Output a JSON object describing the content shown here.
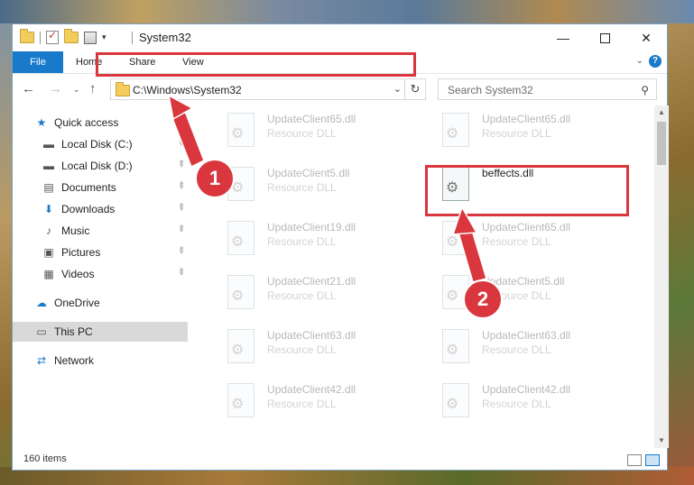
{
  "window": {
    "title": "System32",
    "minimize": "—",
    "close": "✕"
  },
  "ribbon": {
    "tabs": [
      "File",
      "Home",
      "Share",
      "View"
    ],
    "help": "?",
    "chevron": "⌄"
  },
  "nav": {
    "back": "←",
    "forward": "→",
    "recent": "⌄",
    "up": "↑",
    "address": "C:\\Windows\\System32",
    "address_dropdown": "⌄",
    "refresh": "↻",
    "search_placeholder": "Search System32",
    "search_icon": "⚲"
  },
  "sidebar": {
    "items": [
      {
        "label": "Quick access",
        "icon": "star-icon",
        "glyph": "★",
        "pinned": false,
        "selected": false,
        "indent": false
      },
      {
        "label": "Local Disk (C:)",
        "icon": "drive-icon",
        "glyph": "▬",
        "pinned": true,
        "selected": false,
        "indent": true
      },
      {
        "label": "Local Disk (D:)",
        "icon": "drive-icon",
        "glyph": "▬",
        "pinned": true,
        "selected": false,
        "indent": true
      },
      {
        "label": "Documents",
        "icon": "documents-icon",
        "glyph": "▤",
        "pinned": true,
        "selected": false,
        "indent": true
      },
      {
        "label": "Downloads",
        "icon": "download-icon",
        "glyph": "⬇",
        "pinned": true,
        "selected": false,
        "indent": true
      },
      {
        "label": "Music",
        "icon": "music-icon",
        "glyph": "♪",
        "pinned": true,
        "selected": false,
        "indent": true
      },
      {
        "label": "Pictures",
        "icon": "pictures-icon",
        "glyph": "▣",
        "pinned": true,
        "selected": false,
        "indent": true
      },
      {
        "label": "Videos",
        "icon": "video-icon",
        "glyph": "▦",
        "pinned": true,
        "selected": false,
        "indent": true
      },
      {
        "label": "OneDrive",
        "icon": "cloud-icon",
        "glyph": "☁",
        "pinned": false,
        "selected": false,
        "indent": false
      },
      {
        "label": "This PC",
        "icon": "computer-icon",
        "glyph": "▭",
        "pinned": false,
        "selected": true,
        "indent": false
      },
      {
        "label": "Network",
        "icon": "network-icon",
        "glyph": "⇄",
        "pinned": false,
        "selected": false,
        "indent": false
      }
    ],
    "pin_glyph": "📌"
  },
  "files": [
    {
      "name": "UpdateClient65.dll",
      "type": "Resource DLL",
      "active": false
    },
    {
      "name": "UpdateClient65.dll",
      "type": "Resource DLL",
      "active": false
    },
    {
      "name": "UpdateClient5.dll",
      "type": "Resource DLL",
      "active": false
    },
    {
      "name": "beffects.dll",
      "type": "",
      "active": true
    },
    {
      "name": "UpdateClient19.dll",
      "type": "Resource DLL",
      "active": false
    },
    {
      "name": "UpdateClient65.dll",
      "type": "Resource DLL",
      "active": false
    },
    {
      "name": "UpdateClient21.dll",
      "type": "Resource DLL",
      "active": false
    },
    {
      "name": "UpdateClient5.dll",
      "type": "Resource DLL",
      "active": false
    },
    {
      "name": "UpdateClient63.dll",
      "type": "Resource DLL",
      "active": false
    },
    {
      "name": "UpdateClient63.dll",
      "type": "Resource DLL",
      "active": false
    },
    {
      "name": "UpdateClient42.dll",
      "type": "Resource DLL",
      "active": false
    },
    {
      "name": "UpdateClient42.dll",
      "type": "Resource DLL",
      "active": false
    }
  ],
  "status": {
    "item_count": "160 items"
  },
  "annotations": {
    "badge1": "1",
    "badge2": "2",
    "color": "#d9363e"
  }
}
